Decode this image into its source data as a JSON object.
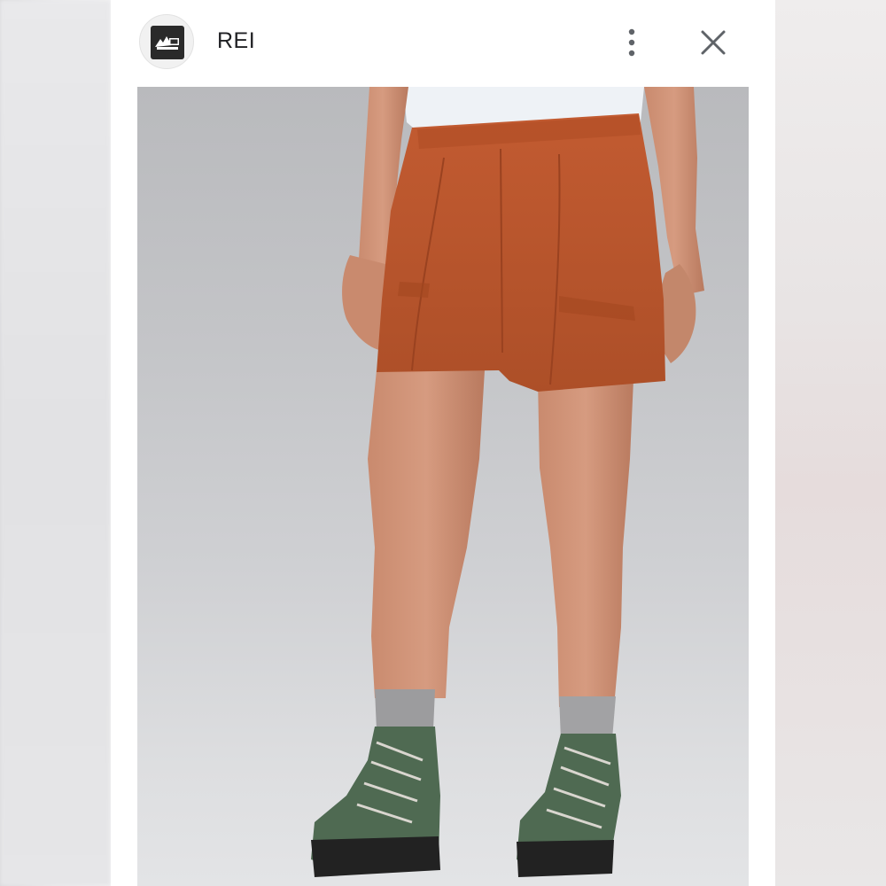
{
  "header": {
    "site_name": "REI",
    "logo_icon": "rei-logo-icon",
    "menu_icon": "more-vert-icon",
    "close_icon": "close-icon"
  },
  "image": {
    "subject": "product-photo"
  },
  "colors": {
    "shorts": "#b8552d",
    "background": "#ffffff",
    "header_text": "#202124",
    "icon": "#5f6368"
  }
}
